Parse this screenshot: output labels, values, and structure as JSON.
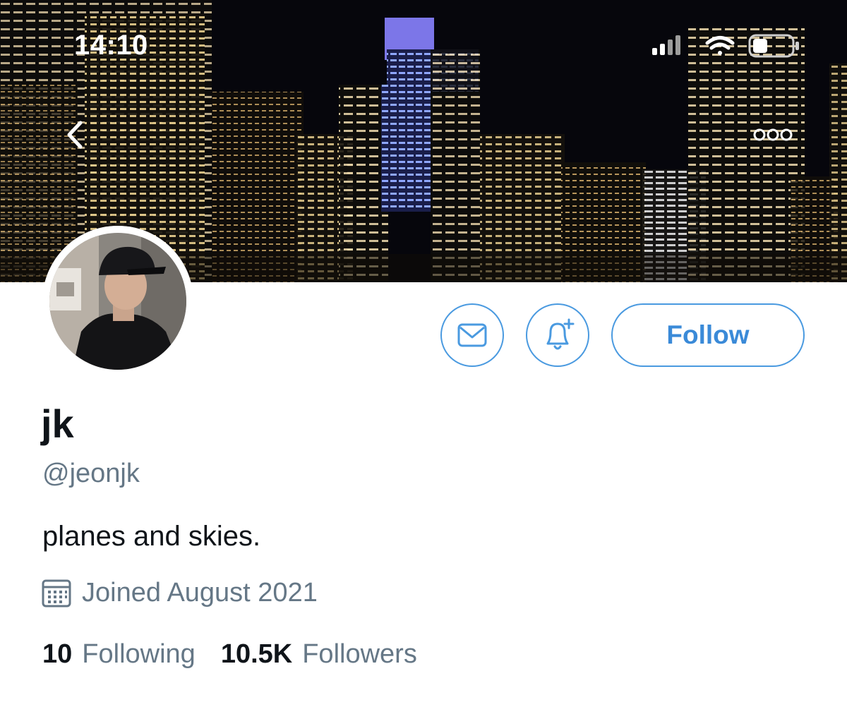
{
  "status_bar": {
    "time": "14:10",
    "icons": [
      "signal-icon",
      "wifi-icon",
      "battery-icon"
    ]
  },
  "header": {
    "back_icon": "chevron-left-icon",
    "more_icon": "more-horizontal-icon",
    "banner": "night city skyline photo"
  },
  "profile": {
    "display_name": "jk",
    "handle": "@jeonjk",
    "bio": "planes and skies.",
    "joined": "Joined August 2021",
    "following_count": "10",
    "following_label": "Following",
    "followers_count": "10.5K",
    "followers_label": "Followers"
  },
  "actions": {
    "message_icon": "envelope-icon",
    "notify_icon": "bell-plus-icon",
    "follow_label": "Follow"
  },
  "colors": {
    "accent": "#4a9ae0",
    "secondary_text": "#657786",
    "primary_text": "#0f1419"
  }
}
